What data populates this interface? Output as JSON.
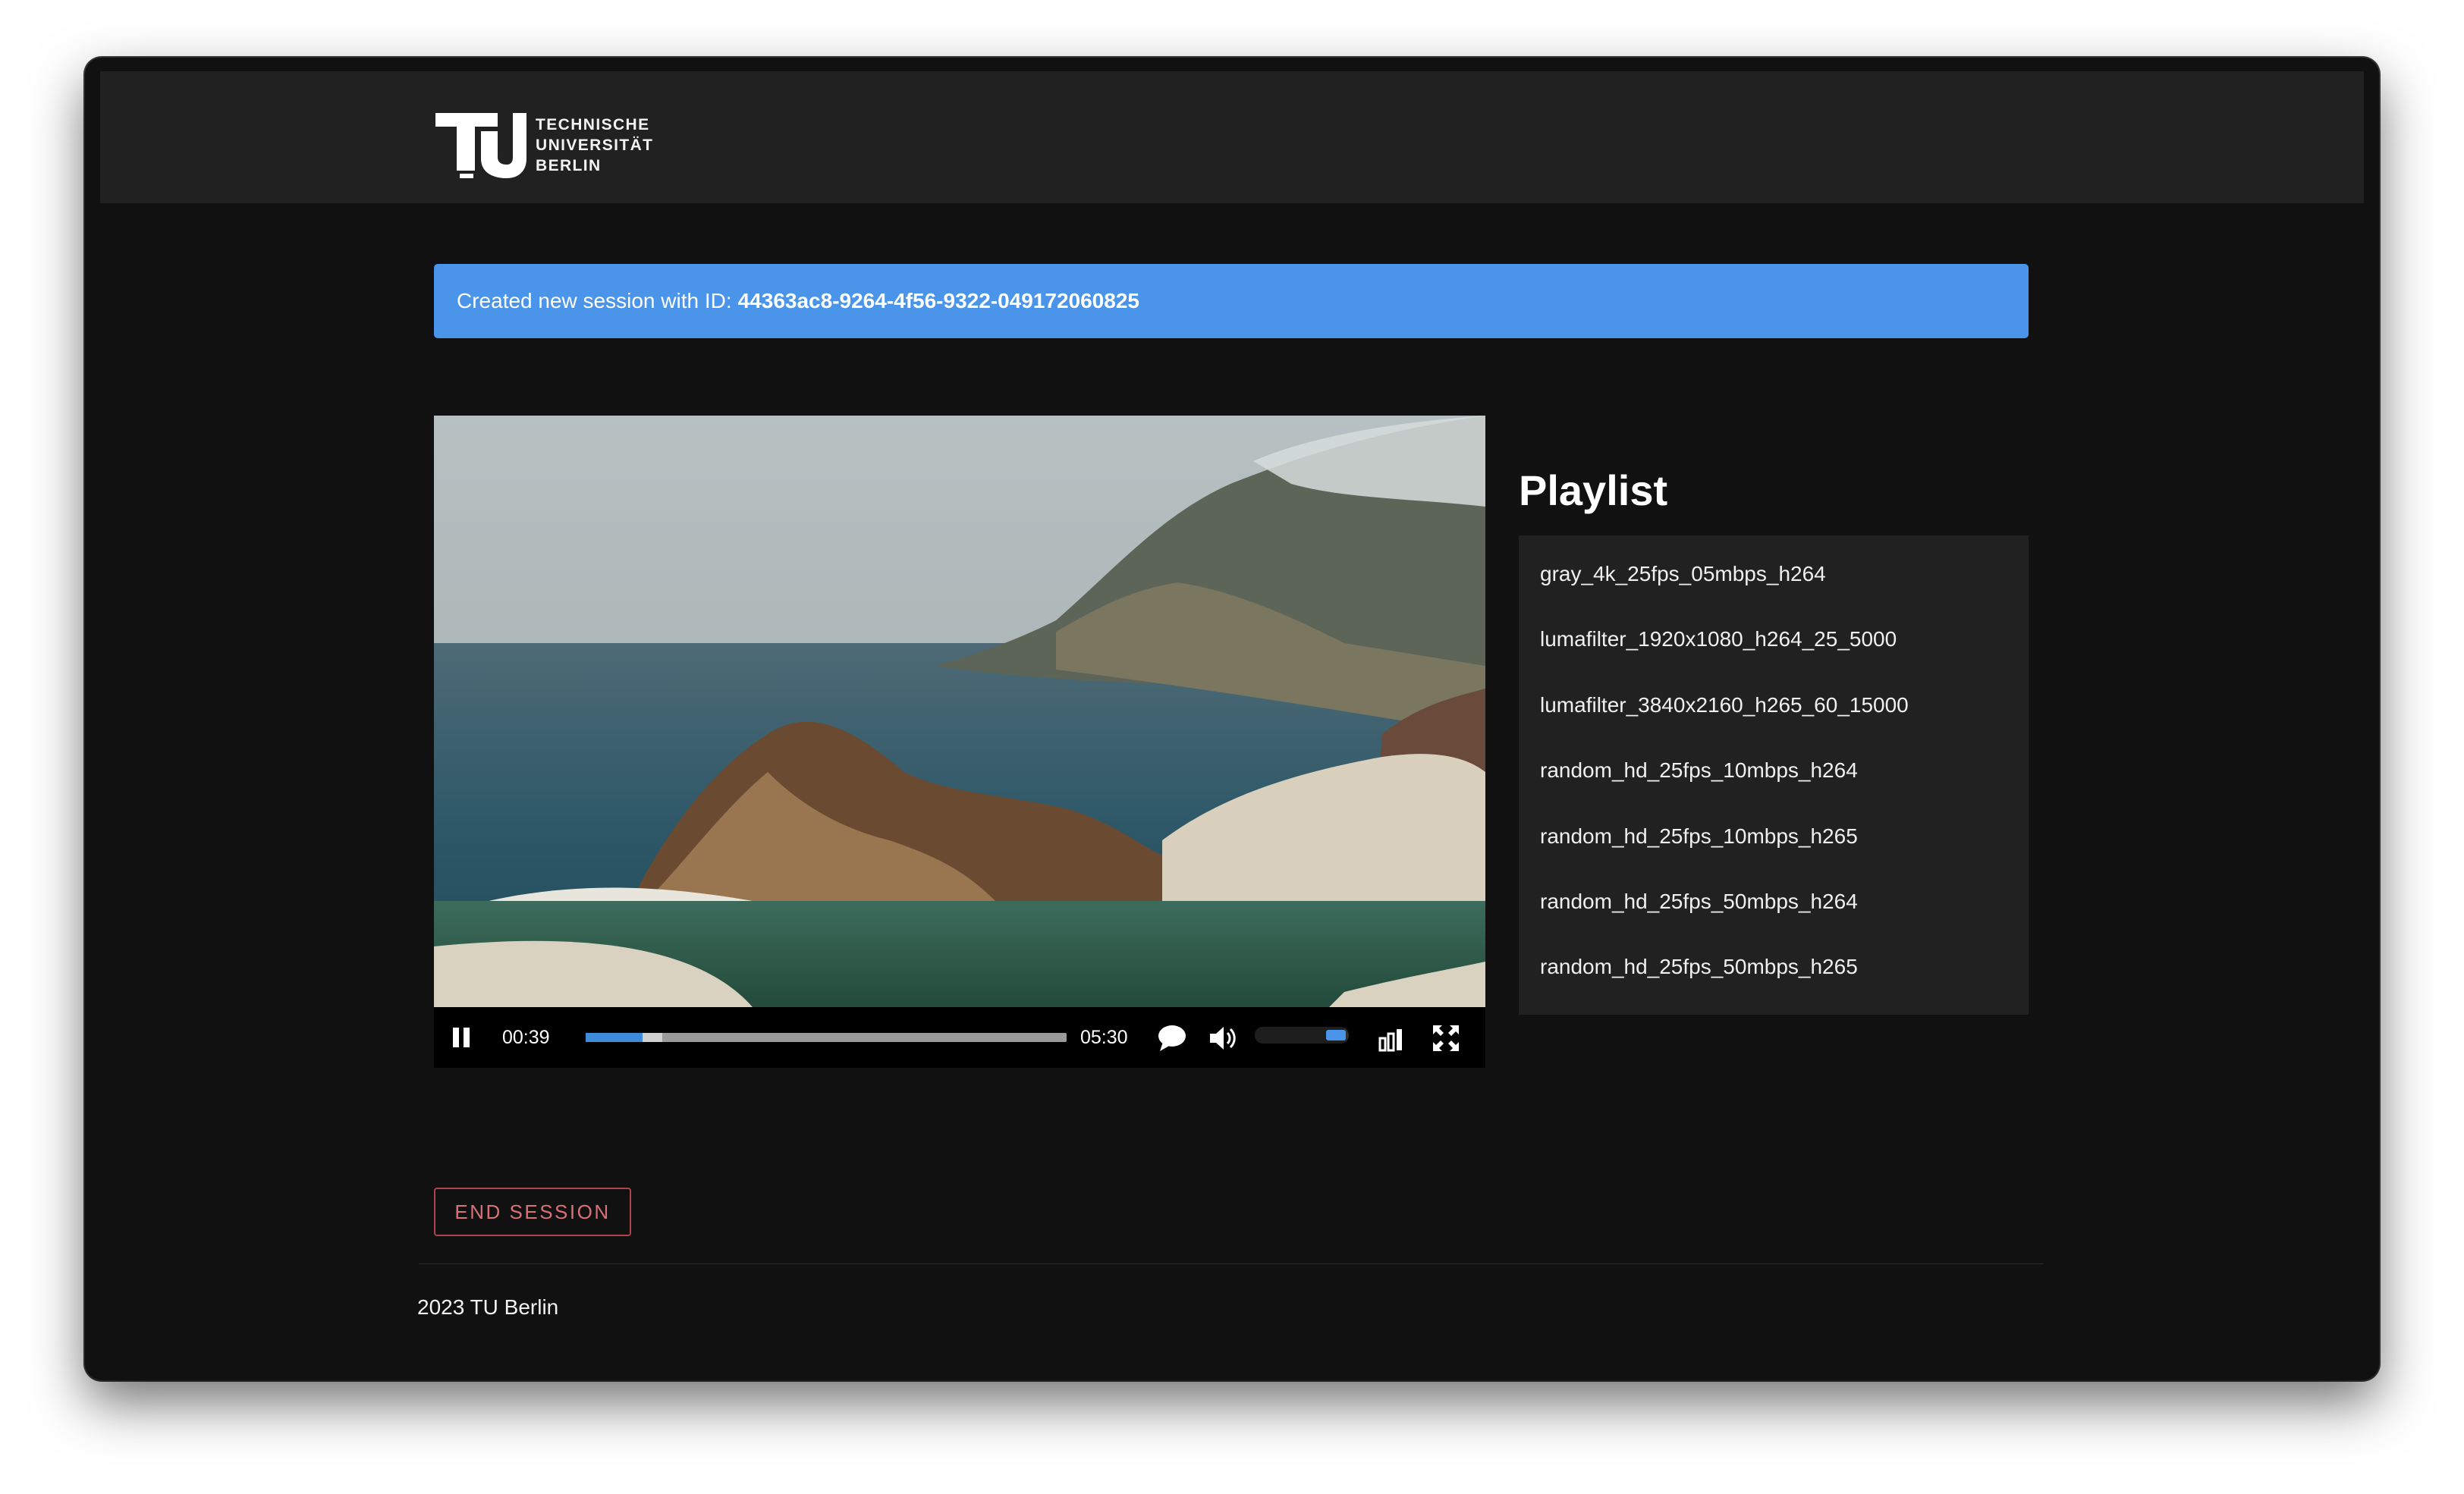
{
  "brand": {
    "line1": "TECHNISCHE",
    "line2": "UNIVERSITÄT",
    "line3": "BERLIN"
  },
  "alert": {
    "prefix": "Created new session with ID:",
    "session_id": "44363ac8-9264-4f56-9322-049172060825"
  },
  "player": {
    "current_time": "00:39",
    "duration": "05:30",
    "progress_fraction": 0.118,
    "buffered_fraction": 0.16,
    "volume_fraction": 0.95
  },
  "playlist": {
    "title": "Playlist",
    "items": [
      "gray_4k_25fps_05mbps_h264",
      "lumafilter_1920x1080_h264_25_5000",
      "lumafilter_3840x2160_h265_60_15000",
      "random_hd_25fps_10mbps_h264",
      "random_hd_25fps_10mbps_h265",
      "random_hd_25fps_50mbps_h264",
      "random_hd_25fps_50mbps_h265"
    ]
  },
  "actions": {
    "end_session": "END SESSION"
  },
  "footer": {
    "text": "2023 TU Berlin"
  },
  "colors": {
    "alert_bg": "#4a94ea",
    "progress": "#3d8bd9",
    "danger": "#b0424a"
  }
}
